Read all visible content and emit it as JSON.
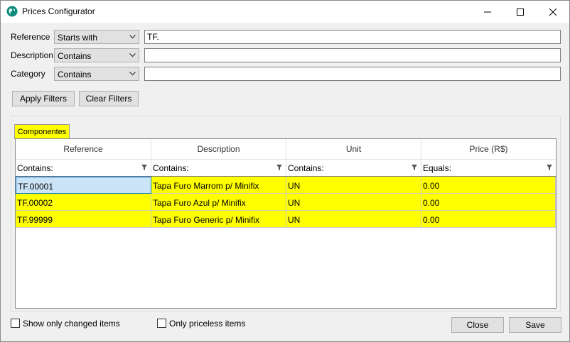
{
  "window": {
    "title": "Prices Configurator"
  },
  "filters": [
    {
      "label": "Reference",
      "mode": "Starts with",
      "value": "TF."
    },
    {
      "label": "Description",
      "mode": "Contains",
      "value": ""
    },
    {
      "label": "Category",
      "mode": "Contains",
      "value": ""
    }
  ],
  "buttons": {
    "apply": "Apply Filters",
    "clear": "Clear Filters",
    "close": "Close",
    "save": "Save"
  },
  "tab": {
    "label": "Componentes"
  },
  "grid": {
    "columns": [
      "Reference",
      "Description",
      "Unit",
      "Price (R$)"
    ],
    "column_filters": [
      "Contains:",
      "Contains:",
      "Contains:",
      "Equals:"
    ],
    "rows": [
      [
        "TF.00001",
        "Tapa Furo Marrom p/ Minifix",
        "UN",
        "0.00"
      ],
      [
        "TF.00002",
        "Tapa Furo Azul p/ Minifix",
        "UN",
        "0.00"
      ],
      [
        "TF.99999",
        "Tapa Furo Generic p/ Minifix",
        "UN",
        "0.00"
      ]
    ]
  },
  "options": {
    "changed": "Show only changed items",
    "priceless": "Only priceless items"
  },
  "colors": {
    "highlight": "#ffff00",
    "selection": "#cce4f7"
  }
}
